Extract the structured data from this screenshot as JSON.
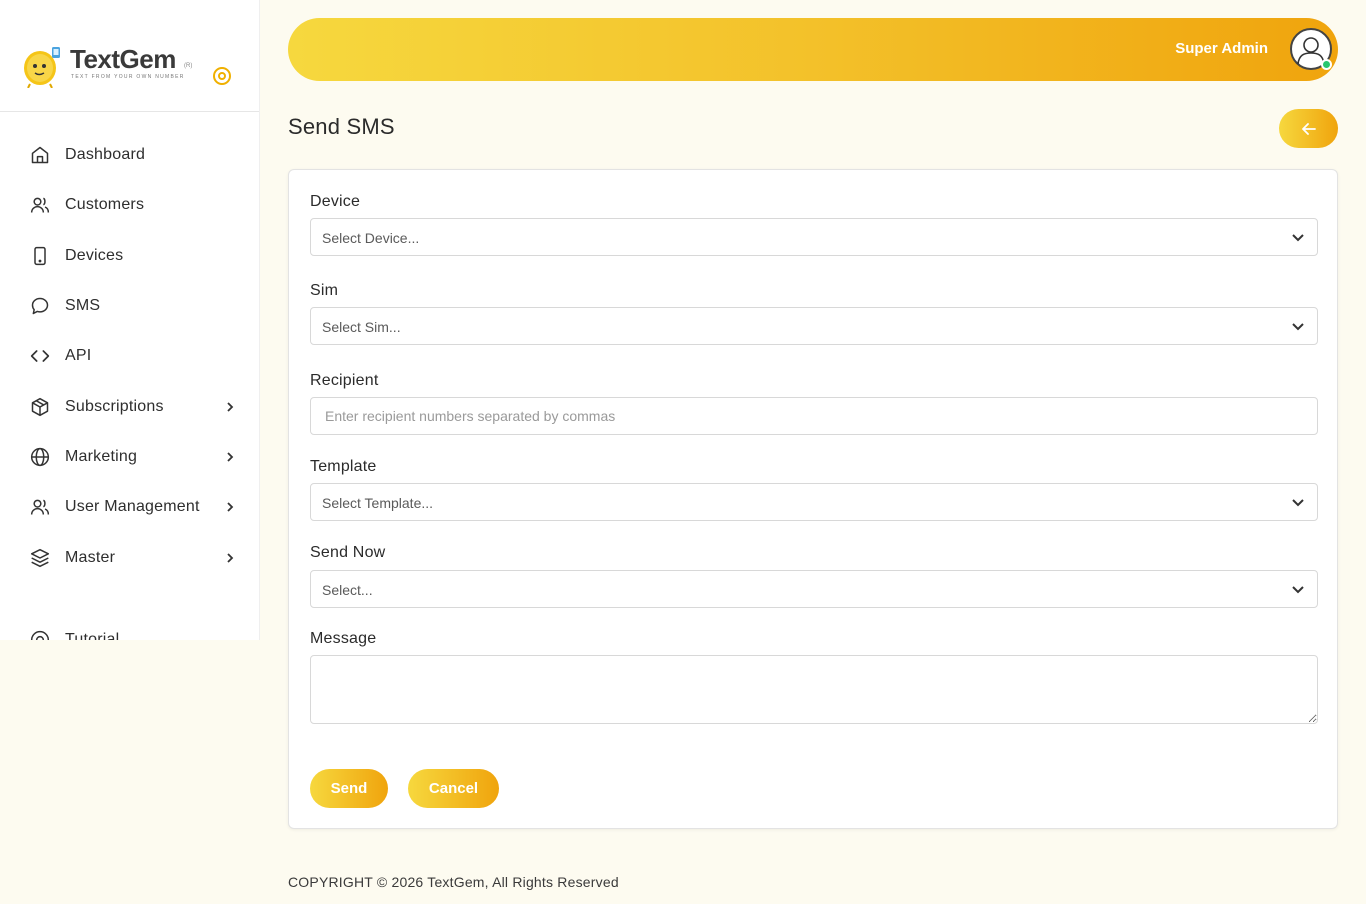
{
  "brand": {
    "name": "TextGem",
    "tm": "(R)",
    "tagline": "TEXT FROM YOUR OWN NUMBER"
  },
  "sidebar": {
    "items": [
      {
        "label": "Dashboard",
        "icon": "home-icon"
      },
      {
        "label": "Customers",
        "icon": "users-icon"
      },
      {
        "label": "Devices",
        "icon": "phone-icon"
      },
      {
        "label": "SMS",
        "icon": "chat-icon"
      },
      {
        "label": "API",
        "icon": "code-icon"
      },
      {
        "label": "Subscriptions",
        "icon": "package-icon",
        "has_submenu": true
      },
      {
        "label": "Marketing",
        "icon": "globe-icon",
        "has_submenu": true
      },
      {
        "label": "User Management",
        "icon": "users-icon",
        "has_submenu": true
      },
      {
        "label": "Master",
        "icon": "layers-icon",
        "has_submenu": true
      },
      {
        "label": "Tutorial",
        "icon": "help-icon"
      }
    ]
  },
  "header": {
    "user_name": "Super Admin"
  },
  "page": {
    "title": "Send SMS"
  },
  "form": {
    "device": {
      "label": "Device",
      "value": "Select Device..."
    },
    "sim": {
      "label": "Sim",
      "value": "Select Sim..."
    },
    "recipient": {
      "label": "Recipient",
      "placeholder": "Enter recipient numbers separated by commas"
    },
    "template": {
      "label": "Template",
      "value": "Select Template..."
    },
    "send_now": {
      "label": "Send Now",
      "value": "Select..."
    },
    "message": {
      "label": "Message",
      "value": ""
    },
    "send_label": "Send",
    "cancel_label": "Cancel"
  },
  "footer": {
    "text": "COPYRIGHT © 2026 TextGem, All Rights Reserved"
  },
  "colors": {
    "accent_start": "#f6d83e",
    "accent_end": "#f0a40d",
    "background": "#fdfbf0",
    "online": "#28c76f"
  }
}
